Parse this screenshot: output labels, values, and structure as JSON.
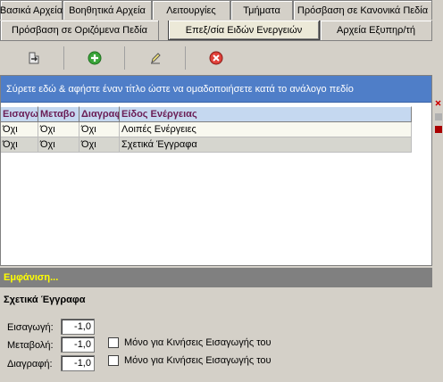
{
  "tabs_row1": [
    {
      "label": "Βασικά Αρχεία"
    },
    {
      "label": "Βοηθητικά Αρχεία"
    },
    {
      "label": "Λειτουργίες"
    },
    {
      "label": "Τμήματα"
    },
    {
      "label": "Πρόσβαση σε Κανονικά Πεδία"
    }
  ],
  "tabs_row2": [
    {
      "label": "Πρόσβαση σε Οριζόμενα Πεδία"
    },
    {
      "label": "Επεξ/σία Ειδών Ενεργειών",
      "active": true
    },
    {
      "label": "Αρχεία Εξυπηρ/τή"
    }
  ],
  "toolbar": [
    {
      "icon": "import-icon"
    },
    {
      "icon": "add-icon"
    },
    {
      "icon": "edit-icon"
    },
    {
      "icon": "delete-icon"
    }
  ],
  "grid": {
    "group_prompt": "Σύρετε εδώ & αφήστε έναν τίτλο ώστε να ομαδοποιήσετε κατά το ανάλογο πεδίο",
    "columns": [
      "Εισαγω",
      "Μεταβο",
      "Διαγραφ",
      "Είδος Ενέργειας"
    ],
    "rows": [
      [
        "Όχι",
        "Όχι",
        "Όχι",
        "Λοιπές Ενέργειες"
      ],
      [
        "Όχι",
        "Όχι",
        "Όχι",
        "Σχετικά Έγγραφα"
      ]
    ]
  },
  "detail": {
    "header": "Εμφάνιση...",
    "title": "Σχετικά Έγγραφα",
    "fields": [
      {
        "label": "Εισαγωγή:",
        "value": "-1,0"
      },
      {
        "label": "Μεταβολή:",
        "value": "-1,0"
      },
      {
        "label": "Διαγραφή:",
        "value": "-1,0"
      }
    ],
    "checkboxes": [
      {
        "label": "Μόνο για Κινήσεις Εισαγωγής του"
      },
      {
        "label": "Μόνο για Κινήσεις Εισαγωγής του"
      }
    ]
  },
  "colors": {
    "group_band": "#4f7ec8",
    "header_text": "#6a1d55",
    "detail_header_text": "#ffff00"
  }
}
